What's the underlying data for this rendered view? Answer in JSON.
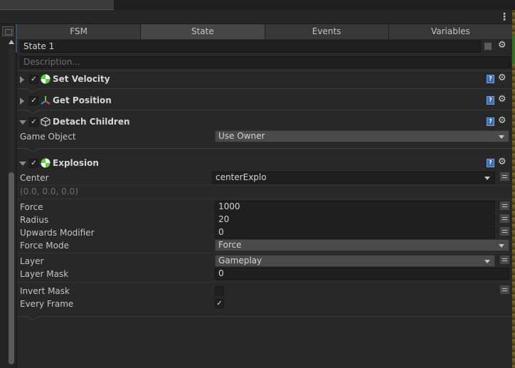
{
  "tabs": [
    "FSM",
    "State",
    "Events",
    "Variables"
  ],
  "state": {
    "name": "State 1",
    "description_placeholder": "Description..."
  },
  "actions": {
    "set_velocity": {
      "title": "Set Velocity"
    },
    "get_position": {
      "title": "Get Position"
    },
    "detach_children": {
      "title": "Detach Children",
      "game_object_label": "Game Object",
      "game_object_value": "Use Owner"
    },
    "explosion": {
      "title": "Explosion",
      "center_label": "Center",
      "center_value": "centerExplo",
      "center_vector": "(0.0, 0.0, 0.0)",
      "force_label": "Force",
      "force_value": "1000",
      "radius_label": "Radius",
      "radius_value": "20",
      "upwards_label": "Upwards Modifier",
      "upwards_value": "0",
      "force_mode_label": "Force Mode",
      "force_mode_value": "Force",
      "layer_label": "Layer",
      "layer_value": "Gameplay",
      "layer_mask_label": "Layer Mask",
      "layer_mask_value": "0",
      "invert_mask_label": "Invert Mask",
      "invert_mask_checked": false,
      "every_frame_label": "Every Frame",
      "every_frame_checked": true
    }
  },
  "icons": {
    "help": "?",
    "gear": "⚙",
    "check": "✓",
    "kebab": "⋮"
  },
  "colors": {
    "help_blue": "#3a6db5",
    "icon_green": "#5fcf3a"
  }
}
